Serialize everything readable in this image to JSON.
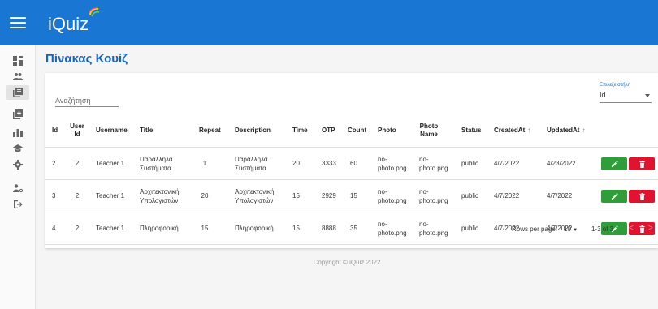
{
  "app": {
    "title": "iQuiz"
  },
  "page": {
    "title": "Πίνακας Κουίζ"
  },
  "search": {
    "placeholder": "Αναζήτηση"
  },
  "column_select": {
    "label": "Επιλεξε στήλη",
    "value": "Id"
  },
  "table": {
    "headers": {
      "id": "Id",
      "user_id": "User Id",
      "username": "Username",
      "title": "Title",
      "repeat": "Repeat",
      "description": "Description",
      "time": "Time",
      "otp": "OTP",
      "count": "Count",
      "photo": "Photo",
      "photo_name": "Photo Name",
      "status": "Status",
      "created_at": "CreatedAt",
      "updated_at": "UpdatedAt",
      "sort_arrow": "↑"
    },
    "rows": [
      {
        "id": "2",
        "user_id": "2",
        "username": "Teacher 1",
        "title": "Παράλληλα Συστήματα",
        "repeat": "1",
        "description": "Παράλληλα Συστήματα",
        "time": "20",
        "otp": "3333",
        "count": "60",
        "photo": "no-photo.png",
        "photo_name": "no-photo.png",
        "status": "public",
        "created_at": "4/7/2022",
        "updated_at": "4/23/2022"
      },
      {
        "id": "3",
        "user_id": "2",
        "username": "Teacher 1",
        "title": "Αρχιτεκτονική Υπολογιστών",
        "repeat": "20",
        "description": "Αρχιτεκτονική Υπολογιστών",
        "time": "15",
        "otp": "2929",
        "count": "15",
        "photo": "no-photo.png",
        "photo_name": "no-photo.png",
        "status": "public",
        "created_at": "4/7/2022",
        "updated_at": "4/7/2022"
      },
      {
        "id": "4",
        "user_id": "2",
        "username": "Teacher 1",
        "title": "Πληροφορική",
        "repeat": "15",
        "description": "Πληροφορική",
        "time": "15",
        "otp": "8888",
        "count": "35",
        "photo": "no-photo.png",
        "photo_name": "no-photo.png",
        "status": "public",
        "created_at": "4/7/2022",
        "updated_at": "4/7/2022"
      }
    ]
  },
  "pagination": {
    "rows_per_page_label": "Rows per page:",
    "rows_per_page_value": "10",
    "range": "1-3 of 3",
    "prev": "<",
    "next": ">"
  },
  "footer": {
    "text": "Copyright © iQuiz 2022"
  },
  "colors": {
    "primary": "#1976d2",
    "title": "#1565c0",
    "edit": "#2e9d3a",
    "delete": "#e0142f"
  },
  "icons": {
    "sidebar": [
      "dashboard-icon",
      "people-icon",
      "library-books-icon",
      "add-box-icon",
      "bar-chart-icon",
      "school-icon",
      "settings-icon",
      "user-key-icon",
      "logout-icon"
    ],
    "row_actions": [
      "pencil-icon",
      "trash-icon"
    ]
  }
}
